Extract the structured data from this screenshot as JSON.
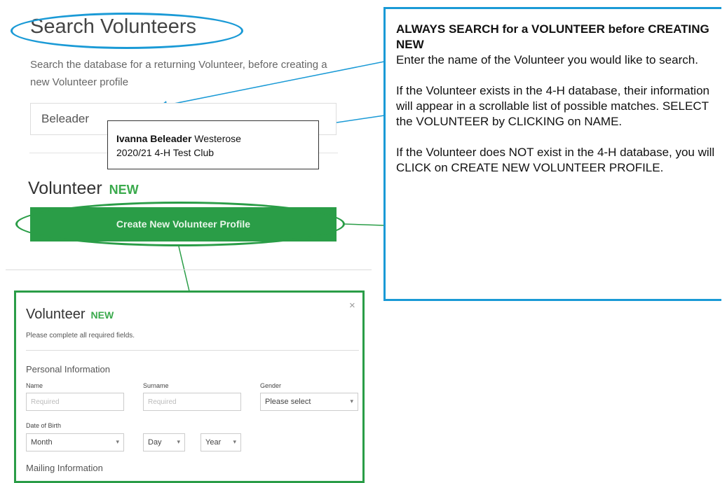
{
  "search": {
    "title": "Search Volunteers",
    "description": "Search the database for a returning Volunteer, before creating a new Volunteer profile",
    "query": "Beleader"
  },
  "result": {
    "name": "Ivanna Beleader",
    "location": "Westerose",
    "club": "2020/21 4-H Test Club"
  },
  "volunteer_section": {
    "heading": "Volunteer",
    "badge": "NEW",
    "create_button": "Create New Volunteer Profile"
  },
  "instructions": {
    "title": "ALWAYS SEARCH for a VOLUNTEER before CREATING NEW",
    "step1": "Enter the name of the Volunteer you would like to search.",
    "step2": "If the Volunteer exists in the 4-H database, their information will appear in a scrollable list of possible matches. SELECT the VOLUNTEER by CLICKING on NAME.",
    "step3": "If the Volunteer does NOT exist in the 4-H database, you will CLICK on CREATE NEW VOLUNTEER PROFILE."
  },
  "modal": {
    "title": "Volunteer",
    "badge": "NEW",
    "close": "×",
    "subtitle": "Please complete all required fields.",
    "personal_section": "Personal Information",
    "name_label": "Name",
    "name_placeholder": "Required",
    "surname_label": "Surname",
    "surname_placeholder": "Required",
    "gender_label": "Gender",
    "gender_value": "Please select",
    "dob_label": "Date of Birth",
    "month_value": "Month",
    "day_value": "Day",
    "year_value": "Year",
    "mailing_section": "Mailing Information"
  },
  "colors": {
    "accent_blue": "#1a9ad6",
    "accent_green": "#2a9d47"
  }
}
